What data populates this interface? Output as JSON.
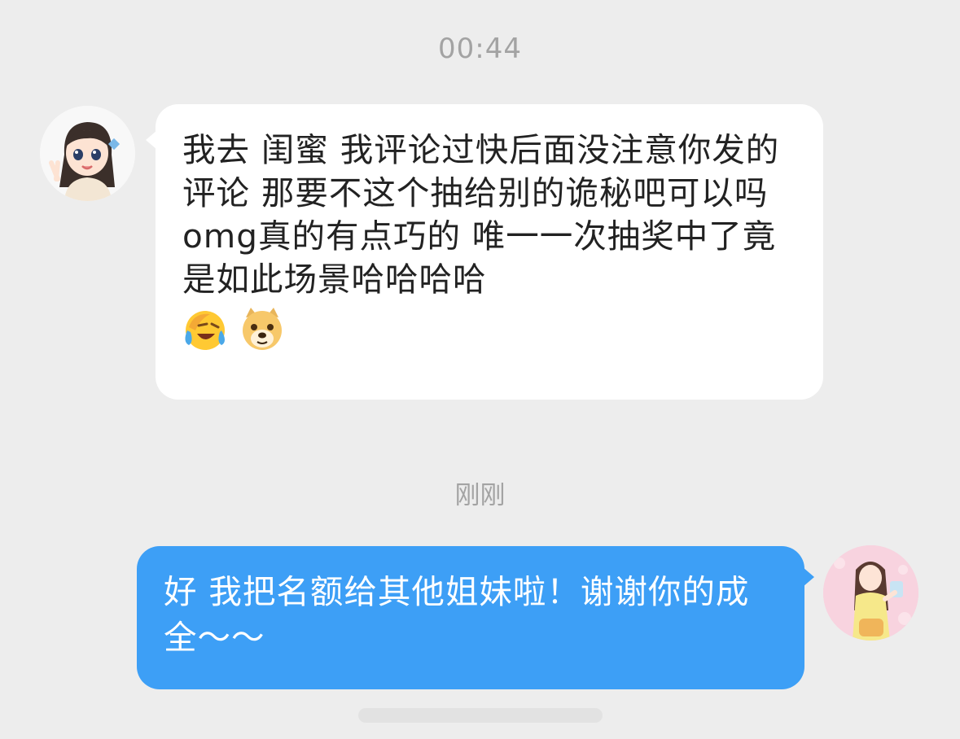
{
  "chat": {
    "timestamp_1": "00:44",
    "timestamp_2": "刚刚",
    "incoming": {
      "text": "我去 闺蜜 我评论过快后面没注意你发的评论 那要不这个抽给别的诡秘吧可以吗 omg真的有点巧的 唯一一次抽奖中了竟是如此场景哈哈哈哈",
      "emojis": [
        "laughing-tears-emoji",
        "doge-emoji"
      ],
      "avatar": "cartoon-girl-avatar"
    },
    "outgoing": {
      "text": "好 我把名额给其他姐妹啦！谢谢你的成全～～",
      "avatar": "illustrated-girl-avatar"
    }
  },
  "colors": {
    "background": "#ededed",
    "incoming_bubble": "#ffffff",
    "outgoing_bubble": "#3d9ff6",
    "timestamp_text": "#a3a3a3"
  }
}
